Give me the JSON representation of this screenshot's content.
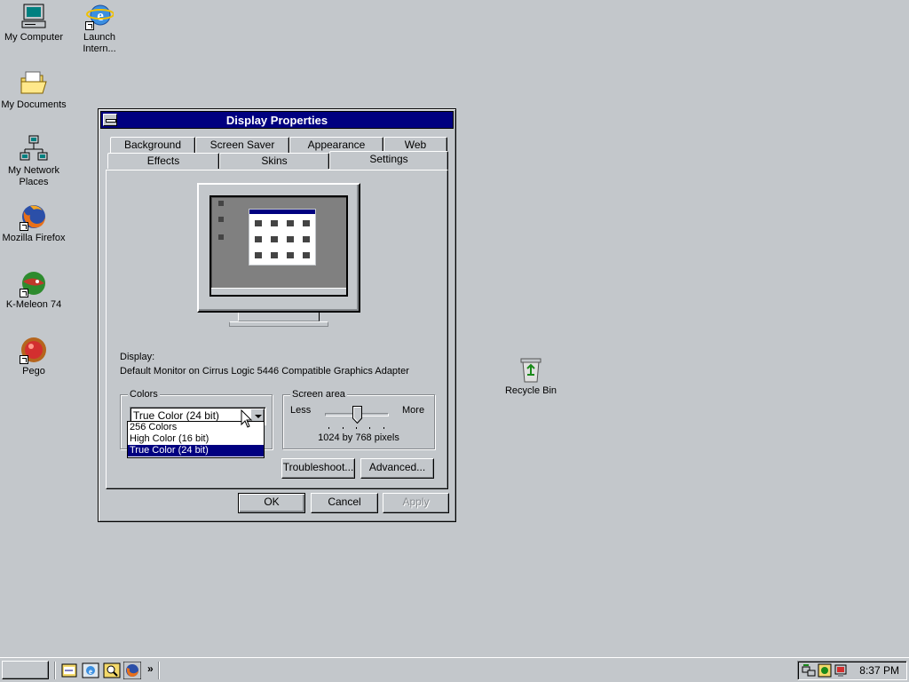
{
  "desktop": {
    "icons": [
      {
        "label": "My Computer",
        "icon": "computer-icon"
      },
      {
        "label": "Launch Intern...",
        "icon": "internet-explorer-icon"
      },
      {
        "label": "My Documents",
        "icon": "folder-icon"
      },
      {
        "label": "My Network Places",
        "icon": "network-icon"
      },
      {
        "label": "Mozilla Firefox",
        "icon": "firefox-icon"
      },
      {
        "label": "K-Meleon 74",
        "icon": "kmeleon-icon"
      },
      {
        "label": "Pego",
        "icon": "pego-icon"
      },
      {
        "label": "Recycle Bin",
        "icon": "recycle-bin-icon"
      }
    ]
  },
  "window": {
    "title": "Display Properties",
    "tabs_back": [
      "Background",
      "Screen Saver",
      "Appearance",
      "Web"
    ],
    "tabs_front": [
      "Effects",
      "Skins",
      "Settings"
    ],
    "active_tab": "Settings",
    "display_label": "Display:",
    "display_value": "Default Monitor on Cirrus Logic 5446 Compatible Graphics Adapter",
    "colors": {
      "legend": "Colors",
      "selected": "True Color (24 bit)",
      "options": [
        "256 Colors",
        "High Color (16 bit)",
        "True Color (24 bit)"
      ]
    },
    "screen_area": {
      "legend": "Screen area",
      "less": "Less",
      "more": "More",
      "resolution": "1024 by 768 pixels",
      "slider_position": 0.5
    },
    "buttons": {
      "troubleshoot": "Troubleshoot...",
      "advanced": "Advanced...",
      "ok": "OK",
      "cancel": "Cancel",
      "apply": "Apply"
    }
  },
  "taskbar": {
    "clock": "8:37 PM",
    "chevron": "»"
  },
  "colors": {
    "desktop": "#c3c7cb",
    "titlebar": "#000080",
    "selection": "#000080"
  }
}
